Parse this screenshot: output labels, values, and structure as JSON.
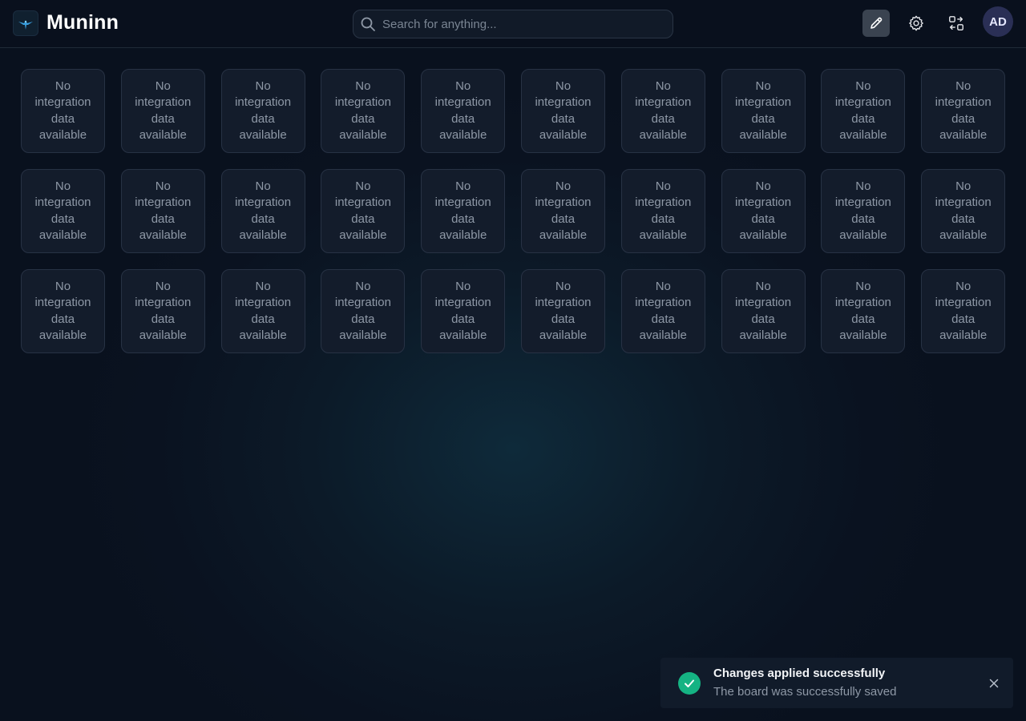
{
  "app": {
    "name": "Muninn"
  },
  "search": {
    "placeholder": "Search for anything..."
  },
  "header": {
    "icons": [
      "pencil-icon",
      "gear-icon",
      "switch-icon"
    ],
    "avatar_initials": "AD"
  },
  "board": {
    "cards": [
      "No integration data available",
      "No integration data available",
      "No integration data available",
      "No integration data available",
      "No integration data available",
      "No integration data available",
      "No integration data available",
      "No integration data available",
      "No integration data available",
      "No integration data available",
      "No integration data available",
      "No integration data available",
      "No integration data available",
      "No integration data available",
      "No integration data available",
      "No integration data available",
      "No integration data available",
      "No integration data available",
      "No integration data available",
      "No integration data available",
      "No integration data available",
      "No integration data available",
      "No integration data available",
      "No integration data available",
      "No integration data available",
      "No integration data available",
      "No integration data available",
      "No integration data available",
      "No integration data available",
      "No integration data available"
    ]
  },
  "toast": {
    "title": "Changes applied successfully",
    "message": "The board was successfully saved",
    "color": "#15b383"
  }
}
